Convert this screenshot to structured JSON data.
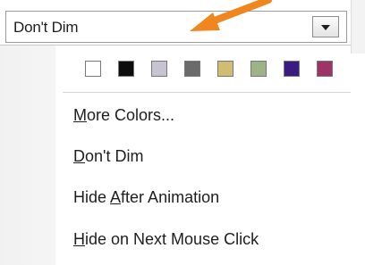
{
  "combo": {
    "value": "Don't Dim"
  },
  "swatch_colors": [
    "#ffffff",
    "#0d0d0d",
    "#c8c3d3",
    "#6b6b6b",
    "#d1bc74",
    "#9db486",
    "#3d1a80",
    "#9e3367"
  ],
  "menu": {
    "items": [
      {
        "pre": "",
        "accel": "M",
        "post": "ore Colors..."
      },
      {
        "pre": "",
        "accel": "D",
        "post": "on't Dim"
      },
      {
        "pre": "Hide ",
        "accel": "A",
        "post": "fter Animation"
      },
      {
        "pre": "",
        "accel": "H",
        "post": "ide on Next Mouse Click"
      }
    ]
  },
  "icons": {
    "dropdown": "chevron-down-icon",
    "annotation": "orange-arrow-icon"
  },
  "colors": {
    "arrow": "#f0871e"
  }
}
